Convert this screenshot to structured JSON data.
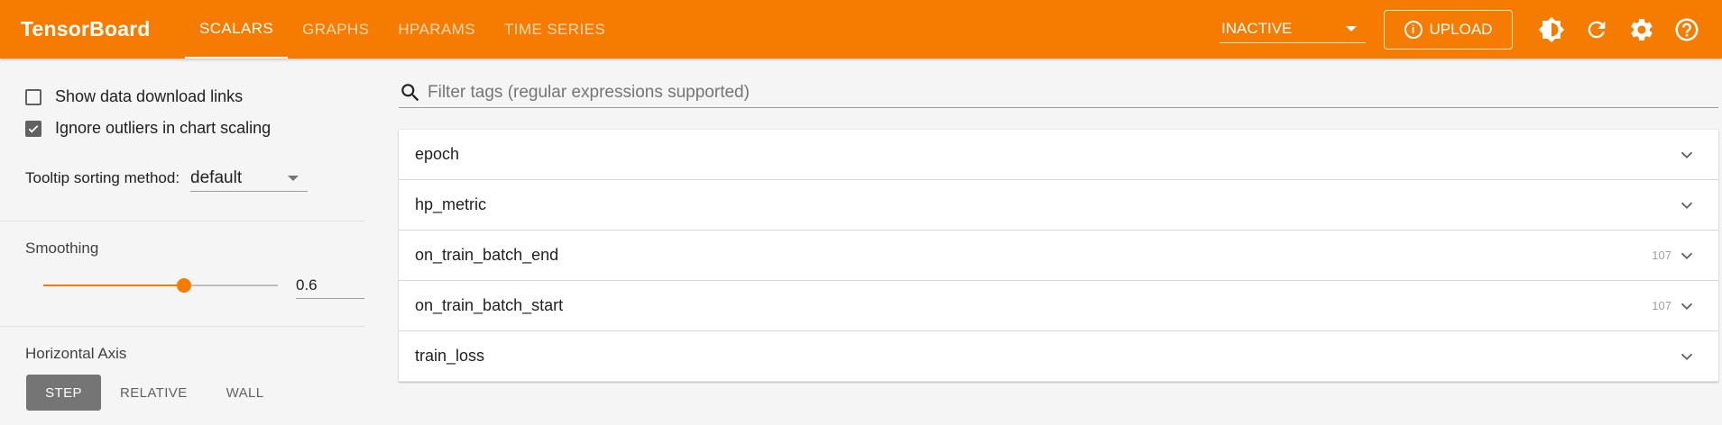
{
  "app": {
    "title": "TensorBoard",
    "accent_color": "#f57c00"
  },
  "tabs": [
    {
      "label": "SCALARS",
      "active": true
    },
    {
      "label": "GRAPHS",
      "active": false
    },
    {
      "label": "HPARAMS",
      "active": false
    },
    {
      "label": "TIME SERIES",
      "active": false
    }
  ],
  "header": {
    "status_value": "INACTIVE",
    "upload_label": "UPLOAD",
    "icons": [
      "dark-mode-icon",
      "refresh-icon",
      "settings-icon",
      "help-icon"
    ]
  },
  "sidebar": {
    "show_download_links": {
      "label": "Show data download links",
      "checked": false
    },
    "ignore_outliers": {
      "label": "Ignore outliers in chart scaling",
      "checked": true
    },
    "tooltip_sorting": {
      "label": "Tooltip sorting method:",
      "value": "default"
    },
    "smoothing": {
      "label": "Smoothing",
      "value": "0.6",
      "fraction": 0.6
    },
    "horizontal_axis": {
      "label": "Horizontal Axis",
      "options": [
        "STEP",
        "RELATIVE",
        "WALL"
      ],
      "selected": "STEP"
    }
  },
  "main": {
    "filter_placeholder": "Filter tags (regular expressions supported)",
    "tag_groups": [
      {
        "name": "epoch",
        "count": ""
      },
      {
        "name": "hp_metric",
        "count": ""
      },
      {
        "name": "on_train_batch_end",
        "count": "107"
      },
      {
        "name": "on_train_batch_start",
        "count": "107"
      },
      {
        "name": "train_loss",
        "count": ""
      }
    ]
  }
}
